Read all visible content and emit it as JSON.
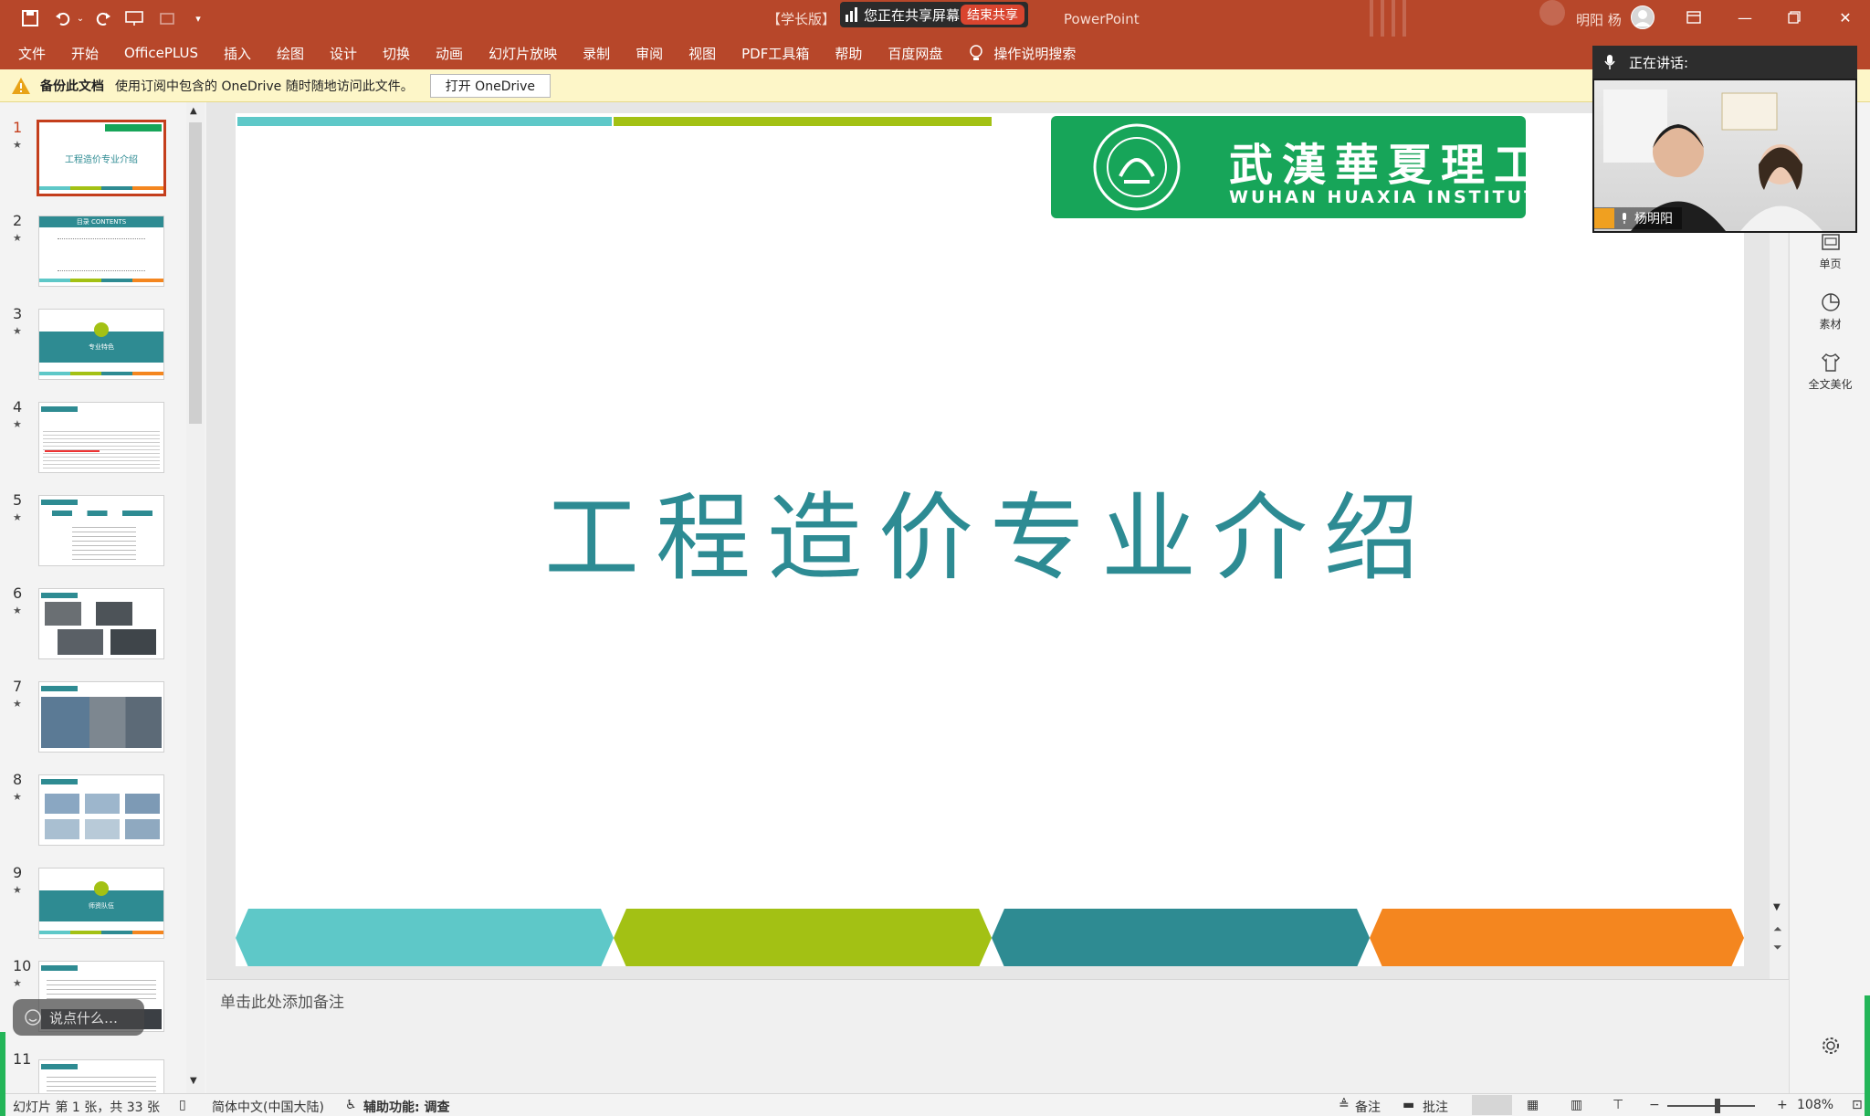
{
  "titlebar": {
    "title": "【学长版】",
    "app_suffix": "PowerPoint",
    "share_status": "您正在共享屏幕",
    "stop_share": "结束共享",
    "user": "明阳 杨",
    "accent": "#b7472a"
  },
  "ribbon": {
    "tabs": [
      "文件",
      "开始",
      "OfficePLUS",
      "插入",
      "绘图",
      "设计",
      "切换",
      "动画",
      "幻灯片放映",
      "录制",
      "审阅",
      "视图",
      "PDF工具箱",
      "帮助",
      "百度网盘"
    ],
    "tell_me": "操作说明搜索"
  },
  "infobar": {
    "title": "备份此文档",
    "message": "使用订阅中包含的 OneDrive 随时随地访问此文件。",
    "button": "打开 OneDrive"
  },
  "thumbnails": [
    {
      "num": "1",
      "label": "工程造价专业介绍"
    },
    {
      "num": "2",
      "label": "目录 CONTENTS"
    },
    {
      "num": "3",
      "label": "专业特色"
    },
    {
      "num": "4",
      "label": ""
    },
    {
      "num": "5",
      "label": ""
    },
    {
      "num": "6",
      "label": ""
    },
    {
      "num": "7",
      "label": ""
    },
    {
      "num": "8",
      "label": ""
    },
    {
      "num": "9",
      "label": "师资队伍"
    },
    {
      "num": "10",
      "label": ""
    },
    {
      "num": "11",
      "label": ""
    }
  ],
  "slide": {
    "logo_cn": "武漢華夏理工",
    "logo_en": "WUHAN HUAXIA INSTITUTE OF TE",
    "title": "工程造价专业介绍",
    "band_colors": [
      "#5ec8c8",
      "#a3c114",
      "#2e8b92",
      "#f4861f"
    ]
  },
  "notes": {
    "placeholder": "单击此处添加备注"
  },
  "rightpanel": {
    "items": [
      "单页",
      "素材",
      "全文美化"
    ]
  },
  "video": {
    "speaking": "正在讲话:",
    "name": "杨明阳"
  },
  "chat": {
    "placeholder": "说点什么…"
  },
  "statusbar": {
    "slide_info": "幻灯片 第 1 张，共 33 张",
    "language": "简体中文(中国大陆)",
    "accessibility": "辅助功能: 调查",
    "notes": "备注",
    "comments": "批注",
    "zoom": "108%"
  }
}
